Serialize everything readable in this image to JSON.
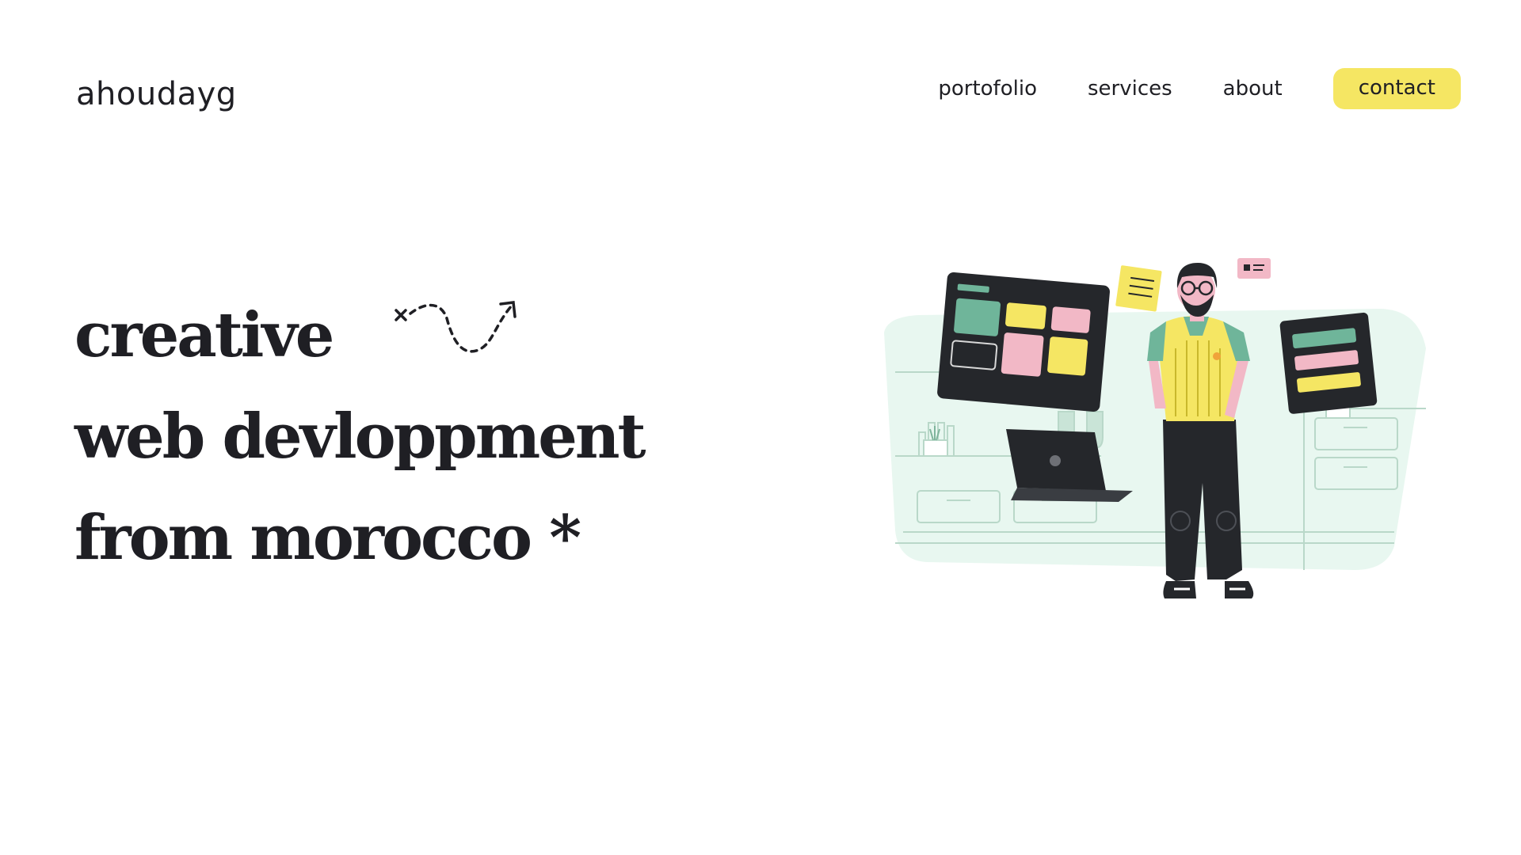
{
  "brand": {
    "logo": "ahoudayg"
  },
  "nav": {
    "links": [
      "portofolio",
      "services",
      "about"
    ],
    "contact_label": "contact"
  },
  "hero": {
    "lines": [
      "creative",
      "web devloppment",
      "from morocco *"
    ]
  },
  "illustration": {
    "icon": "developer-with-dashboards-illustration"
  },
  "colors": {
    "accent": "#f5e663",
    "text": "#1f1f24",
    "mint": "#e8f7f0",
    "teal": "#6fb59a",
    "pink": "#f2b8c6",
    "dark": "#25272b"
  }
}
